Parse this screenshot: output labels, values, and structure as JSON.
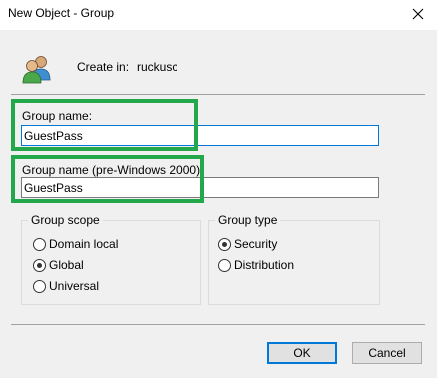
{
  "window": {
    "title": "New Object - Group"
  },
  "create_in": {
    "label": "Create in:",
    "value": "ruckusc",
    "icon": "group-users-icon"
  },
  "group_name": {
    "label": "Group name:",
    "value": "GuestPass"
  },
  "group_name_pre2000": {
    "label": "Group name (pre-Windows 2000):",
    "value": "GuestPass"
  },
  "group_scope": {
    "legend": "Group scope",
    "options": [
      {
        "label": "Domain local",
        "checked": false
      },
      {
        "label": "Global",
        "checked": true
      },
      {
        "label": "Universal",
        "checked": false
      }
    ]
  },
  "group_type": {
    "legend": "Group type",
    "options": [
      {
        "label": "Security",
        "checked": true
      },
      {
        "label": "Distribution",
        "checked": false
      }
    ]
  },
  "buttons": {
    "ok": "OK",
    "cancel": "Cancel"
  },
  "colors": {
    "highlight": "#22a84a",
    "focus_border": "#0078d7",
    "dialog_bg": "#f0f0f0"
  }
}
